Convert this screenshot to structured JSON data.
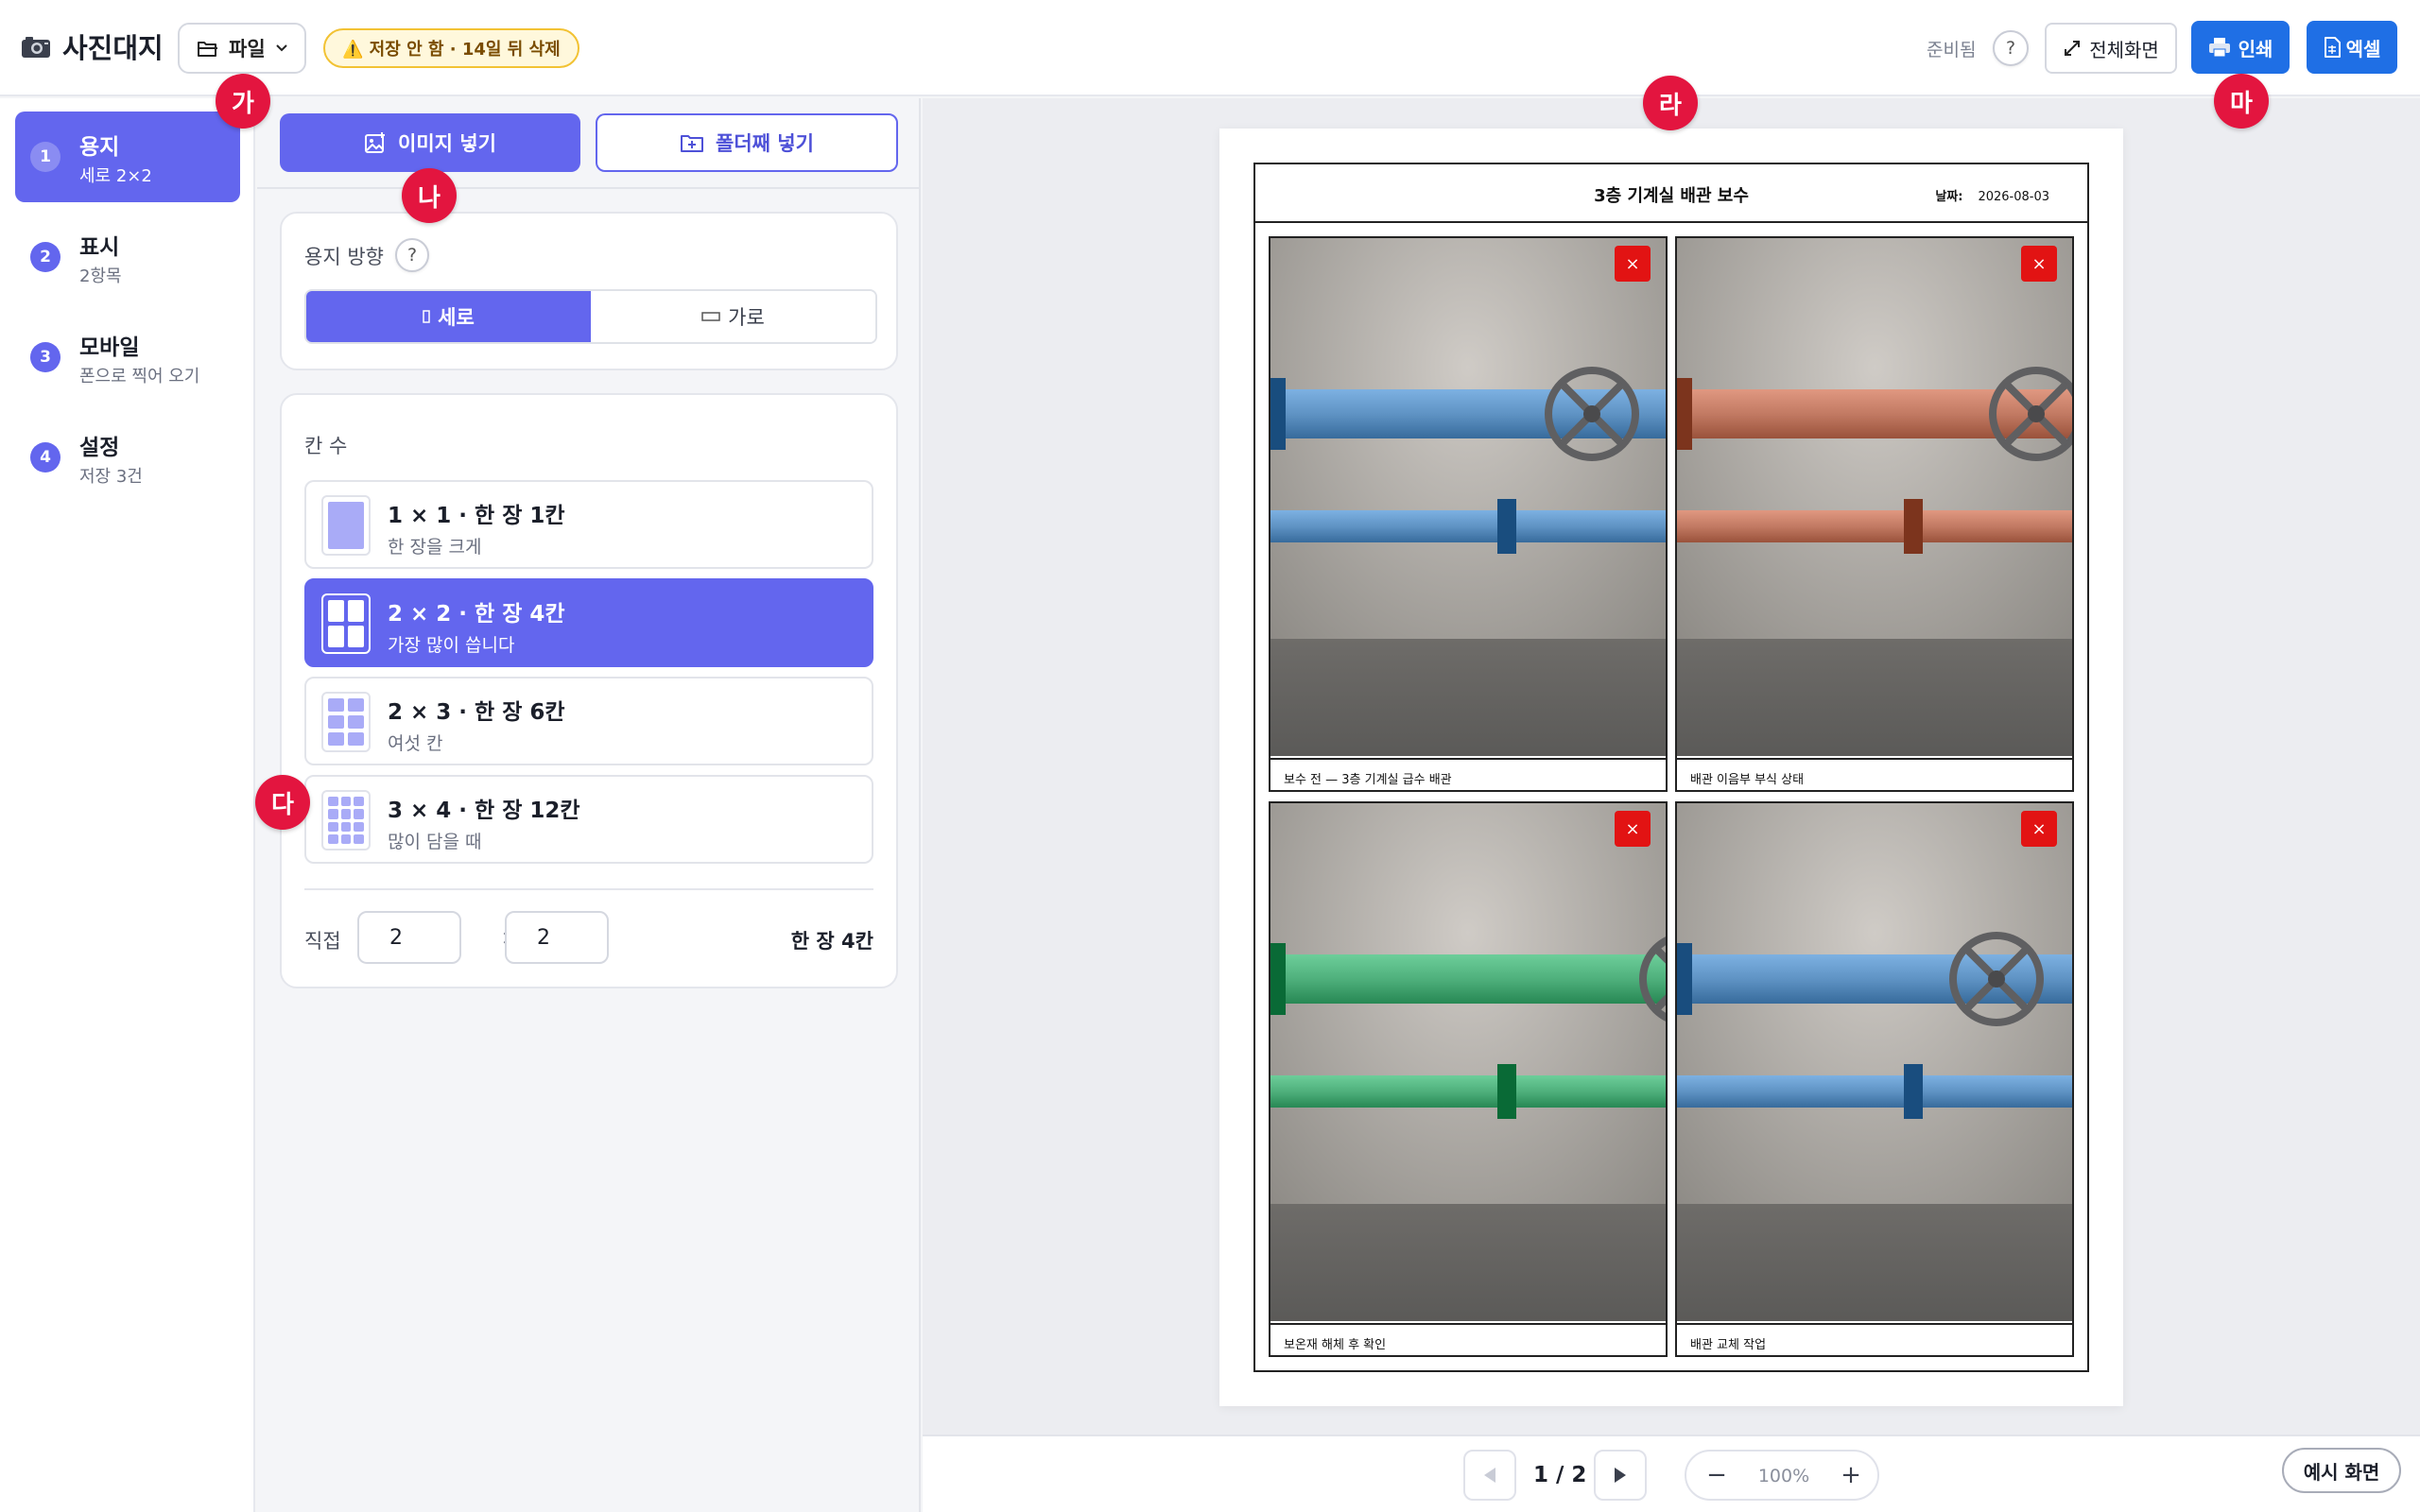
{
  "header": {
    "app_title": "사진대지",
    "file_label": "파일",
    "warning": "⚠️ 저장 안 함 · 14일 뒤 삭제",
    "status": "준비됨",
    "help": "?",
    "fullscreen_label": "전체화면",
    "print_label": "인쇄",
    "excel_label": "엑셀"
  },
  "nav": {
    "items": [
      {
        "num": "1",
        "title": "용지",
        "sub": "세로 2×2",
        "active": true
      },
      {
        "num": "2",
        "title": "표시",
        "sub": "2항목",
        "active": false
      },
      {
        "num": "3",
        "title": "모바일",
        "sub": "폰으로 찍어 오기",
        "active": false
      },
      {
        "num": "4",
        "title": "설정",
        "sub": "저장 3건",
        "active": false
      }
    ]
  },
  "panel": {
    "add_image_label": "이미지 넣기",
    "add_folder_label": "폴더째 넣기",
    "orientation": {
      "label": "용지 방향",
      "help": "?",
      "portrait": "세로",
      "landscape": "가로",
      "selected": "portrait"
    },
    "layout": {
      "label": "칸 수",
      "options": [
        {
          "title": "1 × 1 · 한 장 1칸",
          "sub": "한 장을 크게",
          "rows": 1,
          "cols": 1,
          "active": false
        },
        {
          "title": "2 × 2 · 한 장 4칸",
          "sub": "가장 많이 씁니다",
          "rows": 2,
          "cols": 2,
          "active": true
        },
        {
          "title": "2 × 3 · 한 장 6칸",
          "sub": "여섯 칸",
          "rows": 3,
          "cols": 2,
          "active": false
        },
        {
          "title": "3 × 4 · 한 장 12칸",
          "sub": "많이 담을 때",
          "rows": 4,
          "cols": 3,
          "active": false
        }
      ],
      "custom_label": "직접",
      "custom_rows": "2",
      "custom_cols": "2",
      "times": "×",
      "total": "한 장 4칸"
    }
  },
  "preview": {
    "sheet_title": "3층 기계실 배관 보수",
    "date_label": "날짜:",
    "date_value": "2026-08-03",
    "delete_symbol": "×",
    "photos": [
      {
        "caption": "보수 전 — 3층 기계실 급수 배관",
        "pipe_color": "#5f93c4"
      },
      {
        "caption": "배관 이음부 부식 상태",
        "pipe_color": "#c27a63"
      },
      {
        "caption": "보온재 해체 후 확인",
        "pipe_color": "#4fb07c"
      },
      {
        "caption": "배관 교체 작업",
        "pipe_color": "#5f93c4"
      }
    ]
  },
  "pager": {
    "page_text": "1 / 2",
    "zoom_minus": "−",
    "zoom_value": "100%",
    "zoom_plus": "+",
    "example_label": "예시 화면"
  },
  "markers": [
    "가",
    "나",
    "다",
    "라",
    "마"
  ]
}
